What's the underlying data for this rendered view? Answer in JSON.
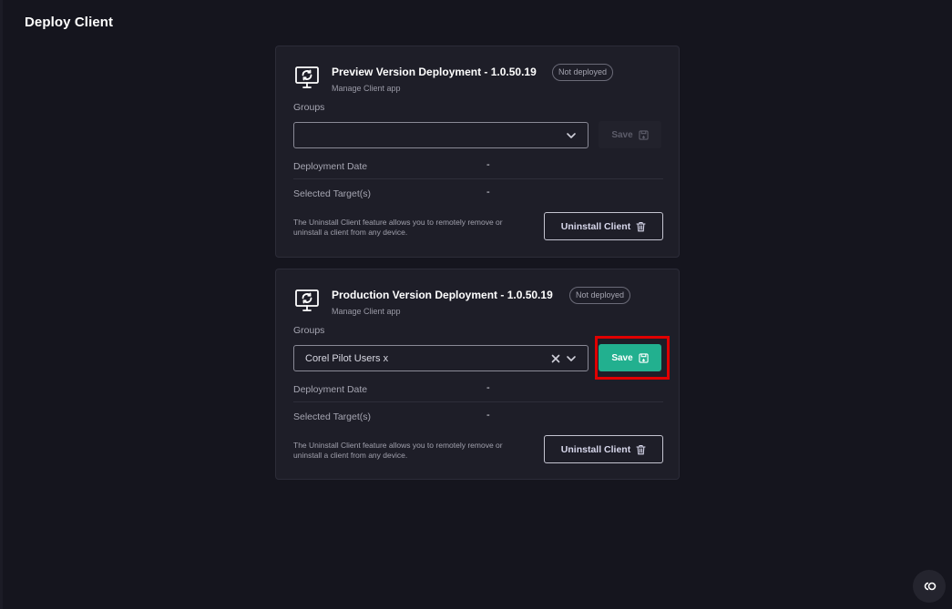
{
  "page": {
    "title": "Deploy Client"
  },
  "cards": [
    {
      "title": "Preview Version Deployment - 1.0.50.19",
      "status": "Not deployed",
      "subtitle": "Manage Client app",
      "groups_label": "Groups",
      "groups_value": "",
      "save_label": "Save",
      "deployment_date_label": "Deployment Date",
      "deployment_date_value": "-",
      "selected_targets_label": "Selected Target(s)",
      "selected_targets_value": "-",
      "uninstall_note": "The Uninstall Client feature allows you to remotely remove or uninstall a client from any device.",
      "uninstall_label": "Uninstall Client"
    },
    {
      "title": "Production Version Deployment - 1.0.50.19",
      "status": "Not deployed",
      "subtitle": "Manage Client app",
      "groups_label": "Groups",
      "groups_value": "Corel Pilot Users x",
      "save_label": "Save",
      "deployment_date_label": "Deployment Date",
      "deployment_date_value": "-",
      "selected_targets_label": "Selected Target(s)",
      "selected_targets_value": "-",
      "uninstall_note": "The Uninstall Client feature allows you to remotely remove or uninstall a client from any device.",
      "uninstall_label": "Uninstall Client"
    }
  ],
  "icons": {
    "client": "monitor-refresh-icon",
    "select": "chevron-down-icon",
    "clear": "close-icon",
    "save": "save-icon",
    "uninstall": "trash-icon",
    "help": "chat-support-icon"
  },
  "colors": {
    "background": "#15151e",
    "card": "#1e1e28",
    "accent": "#22b08f",
    "highlight": "#e00000"
  }
}
